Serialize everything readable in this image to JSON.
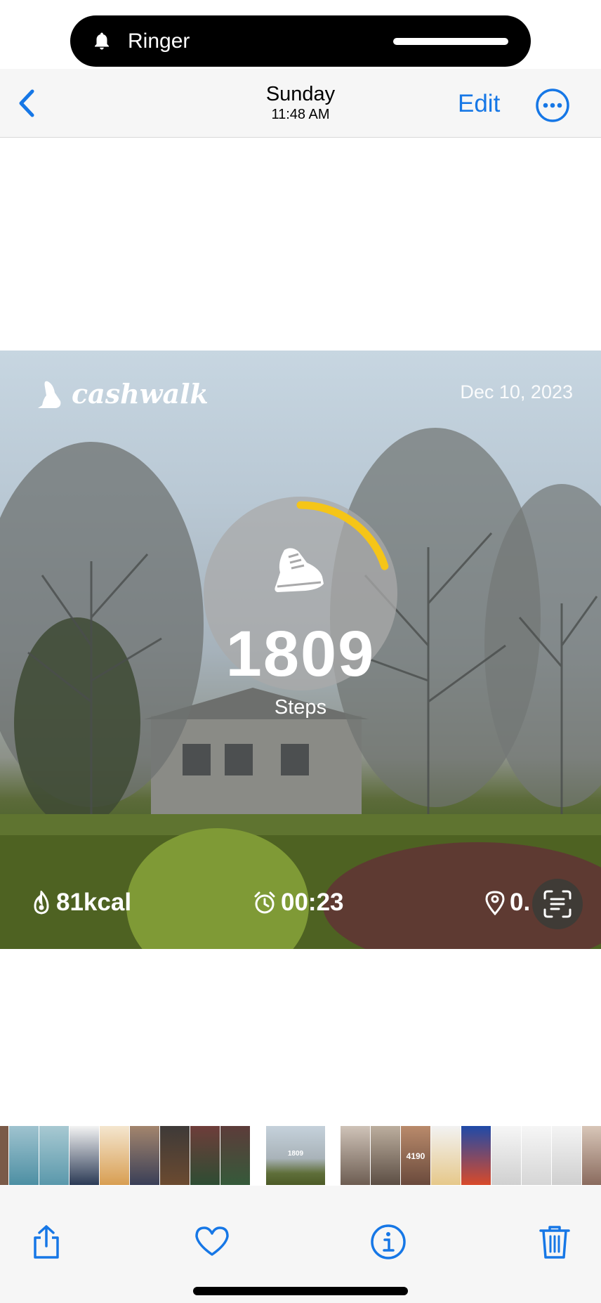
{
  "status": {
    "ringer_label": "Ringer",
    "icon": "bell-icon"
  },
  "nav": {
    "day": "Sunday",
    "time": "11:48 AM",
    "edit_label": "Edit",
    "back_icon": "chevron-left-icon",
    "more_icon": "ellipsis-circle-icon",
    "accent_color": "#1677e6"
  },
  "photo": {
    "brand_name": "cashwalk",
    "date": "Dec 10, 2023",
    "steps": "1809",
    "steps_label": "Steps",
    "step_progress": 0.2,
    "ring_color": "#f5c518",
    "calories": "81kcal",
    "duration": "00:23",
    "distance": "0.",
    "livetext_icon": "live-text-icon"
  },
  "thumbnails": {
    "current_steps": "1809",
    "other_steps": "4190"
  },
  "toolbar": {
    "share_icon": "share-icon",
    "like_icon": "heart-icon",
    "info_icon": "info-icon",
    "delete_icon": "trash-icon"
  }
}
